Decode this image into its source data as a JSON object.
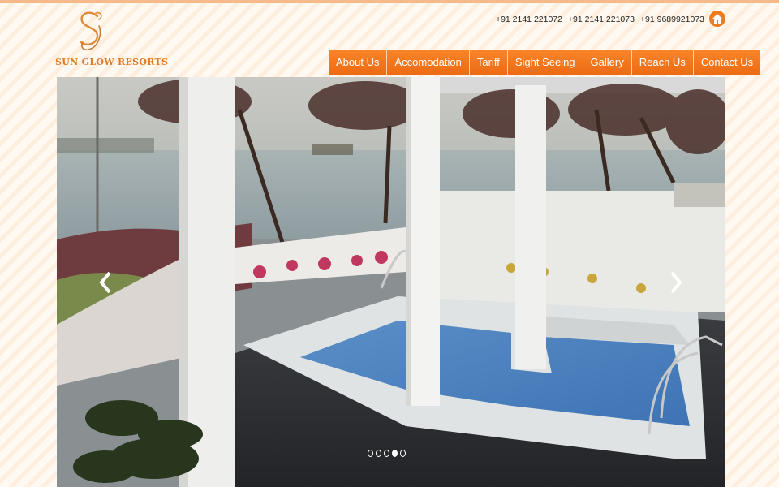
{
  "brand": {
    "name": "SUN GLOW RESORTS",
    "monogram": "SG"
  },
  "header": {
    "phones": [
      "+91 2141 221072",
      "+91 2141 221073",
      "+91 9689921073"
    ],
    "home_icon": "home-icon"
  },
  "nav": {
    "items": [
      {
        "label": "About Us"
      },
      {
        "label": "Accomodation"
      },
      {
        "label": "Tariff"
      },
      {
        "label": "Sight Seeing"
      },
      {
        "label": "Gallery"
      },
      {
        "label": "Reach Us"
      },
      {
        "label": "Contact Us"
      }
    ]
  },
  "slider": {
    "slide_count": 5,
    "active_slide": 4,
    "prev_icon": "chevron-left-icon",
    "next_icon": "chevron-right-icon"
  },
  "colors": {
    "accent": "#f07a1e",
    "nav_bg": "#f47a22",
    "logo_text": "#e47a20",
    "background_stripe": "#fdeedd"
  }
}
